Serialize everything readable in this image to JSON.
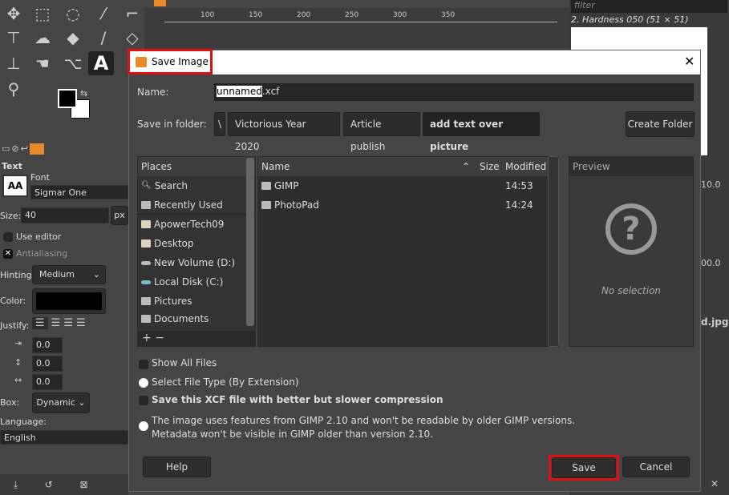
{
  "gimp": {
    "tool_options": {
      "section": "Text",
      "font_label": "Font",
      "font": "Sigmar One",
      "size_label": "Size:",
      "size": "40",
      "size_unit": "px",
      "use_editor": "Use editor",
      "antialiasing": "Antialiasing",
      "hinting_label": "Hinting:",
      "hinting": "Medium",
      "color_label": "Color:",
      "text_color": "#000000",
      "justify_label": "Justify:",
      "indent": "0.0",
      "line_spacing": "0.0",
      "letter_spacing": "0.0",
      "box_label": "Box:",
      "box": "Dynamic",
      "language_label": "Language:",
      "language": "English"
    },
    "ruler_ticks": [
      "100",
      "150",
      "200",
      "250",
      "300",
      "350"
    ],
    "brushes": {
      "filter_placeholder": "filter",
      "brush_name": "2. Hardness 050 (51 × 51)"
    },
    "right_values": [
      "10.0",
      "00.0"
    ],
    "image_tab": "d.jpg"
  },
  "dialog": {
    "title": "Save Image",
    "name_label": "Name:",
    "name_value": "unnamed.xcf",
    "name_selected": "unnamed",
    "name_ext": ".xcf",
    "folder_label": "Save in folder:",
    "breadcrumbs": [
      "\\",
      "Victorious Year 2020",
      "Article publish",
      "add text over picture"
    ],
    "create_folder": "Create Folder",
    "places_header": "Places",
    "places": [
      {
        "label": "Search",
        "icon": "search-icon"
      },
      {
        "label": "Recently Used",
        "icon": "recent-icon"
      },
      {
        "label": "ApowerTech09",
        "icon": "folder-icon"
      },
      {
        "label": "Desktop",
        "icon": "folder-icon"
      },
      {
        "label": "New Volume (D:)",
        "icon": "drive-icon"
      },
      {
        "label": "Local Disk (C:)",
        "icon": "drive-icon"
      },
      {
        "label": "Pictures",
        "icon": "folder-icon"
      },
      {
        "label": "Documents",
        "icon": "folder-icon"
      }
    ],
    "columns": {
      "name": "Name",
      "size": "Size",
      "modified": "Modified"
    },
    "files": [
      {
        "name": "GIMP",
        "size": "",
        "modified": "14:53"
      },
      {
        "name": "PhotoPad",
        "size": "",
        "modified": "14:24"
      }
    ],
    "preview_header": "Preview",
    "preview_empty": "No selection",
    "show_all_files": "Show All Files",
    "select_file_type": "Select File Type (By Extension)",
    "compression": "Save this XCF file with better but slower compression",
    "info_line1": "The image uses features from GIMP 2.10 and won't be readable by older GIMP versions.",
    "info_line2": "Metadata won't be visible in GIMP older than version 2.10.",
    "help": "Help",
    "save": "Save",
    "cancel": "Cancel",
    "highlight_color": "#e01010"
  }
}
